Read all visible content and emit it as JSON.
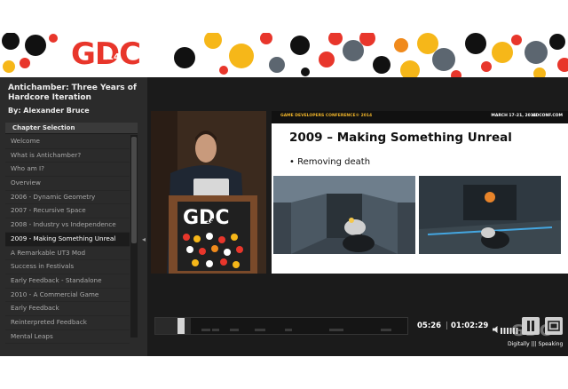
{
  "banner": {
    "logo_text": "GDC",
    "logo_year": "14",
    "colors": {
      "red": "#e8362b",
      "yellow": "#f6b719",
      "black": "#111111",
      "slate": "#5c6670",
      "orange": "#f08a1c",
      "pink": "#ec5a6a"
    }
  },
  "talk": {
    "title": "Antichamber: Three Years of Hardcore Iteration",
    "author": "By: Alexander Bruce"
  },
  "chapters": {
    "header": "Chapter Selection",
    "items": [
      {
        "label": "Welcome",
        "active": false
      },
      {
        "label": "What is Antichamber?",
        "active": false
      },
      {
        "label": "Who am I?",
        "active": false
      },
      {
        "label": "Overview",
        "active": false
      },
      {
        "label": "2006 - Dynamic Geometry",
        "active": false
      },
      {
        "label": "2007 - Recursive Space",
        "active": false
      },
      {
        "label": "2008 - Industry vs Independence",
        "active": false
      },
      {
        "label": "2009 - Making Something Unreal",
        "active": true
      },
      {
        "label": "A Remarkable UT3 Mod",
        "active": false
      },
      {
        "label": "Success in Festivals",
        "active": false
      },
      {
        "label": "Early Feedback - Standalone",
        "active": false
      },
      {
        "label": "2010 - A Commercial Game",
        "active": false
      },
      {
        "label": "Early Feedback",
        "active": false
      },
      {
        "label": "Reinterpreted Feedback",
        "active": false
      },
      {
        "label": "Mental Leaps",
        "active": false
      }
    ],
    "scroll_fraction": 0.5
  },
  "slide": {
    "conference": "GAME DEVELOPERS CONFERENCE® 2014",
    "dates": "MARCH 17–21, 2014",
    "url": "GDCONF.COM",
    "title": "2009 – Making Something Unreal",
    "bullet": "Removing death"
  },
  "podium": {
    "logo_text": "GDC",
    "logo_year": "14"
  },
  "watermark": "GDC",
  "player": {
    "current_time": "05:26",
    "total_time": "01:02:29",
    "progress": 0.087,
    "buffered": 0.14
  },
  "footer": {
    "brand": "Digitally ||| Speaking"
  }
}
